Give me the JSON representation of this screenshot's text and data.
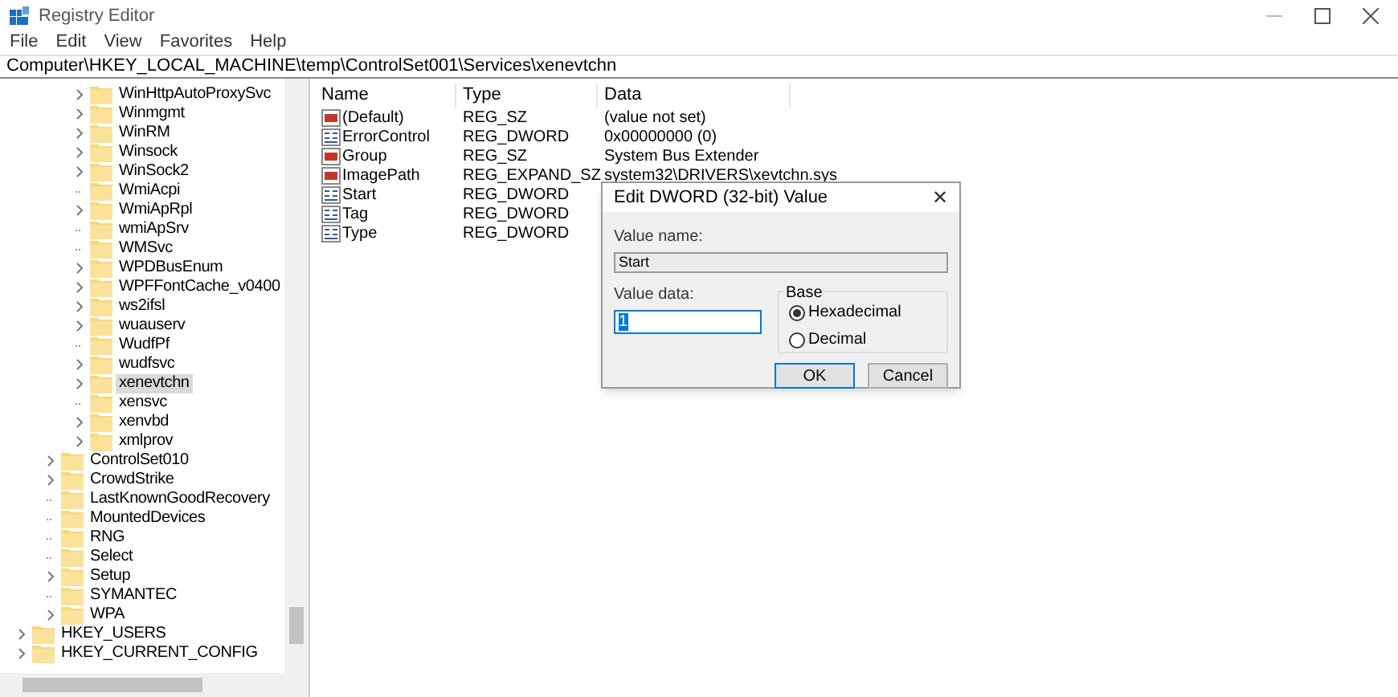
{
  "window": {
    "title": "Registry Editor"
  },
  "menu": [
    "File",
    "Edit",
    "View",
    "Favorites",
    "Help"
  ],
  "address": "Computer\\HKEY_LOCAL_MACHINE\\temp\\ControlSet001\\Services\\xenevtchn",
  "tree": {
    "services": [
      {
        "label": "WinHttpAutoProxySvc",
        "expandable": true,
        "selected": false
      },
      {
        "label": "Winmgmt",
        "expandable": true,
        "selected": false
      },
      {
        "label": "WinRM",
        "expandable": true,
        "selected": false
      },
      {
        "label": "Winsock",
        "expandable": true,
        "selected": false
      },
      {
        "label": "WinSock2",
        "expandable": true,
        "selected": false
      },
      {
        "label": "WmiAcpi",
        "expandable": false,
        "selected": false
      },
      {
        "label": "WmiApRpl",
        "expandable": true,
        "selected": false
      },
      {
        "label": "wmiApSrv",
        "expandable": false,
        "selected": false
      },
      {
        "label": "WMSvc",
        "expandable": false,
        "selected": false
      },
      {
        "label": "WPDBusEnum",
        "expandable": true,
        "selected": false
      },
      {
        "label": "WPFFontCache_v0400",
        "expandable": true,
        "selected": false
      },
      {
        "label": "ws2ifsl",
        "expandable": true,
        "selected": false
      },
      {
        "label": "wuauserv",
        "expandable": true,
        "selected": false
      },
      {
        "label": "WudfPf",
        "expandable": false,
        "selected": false
      },
      {
        "label": "wudfsvc",
        "expandable": true,
        "selected": false
      },
      {
        "label": "xenevtchn",
        "expandable": true,
        "selected": true
      },
      {
        "label": "xensvc",
        "expandable": false,
        "selected": false
      },
      {
        "label": "xenvbd",
        "expandable": true,
        "selected": false
      },
      {
        "label": "xmlprov",
        "expandable": true,
        "selected": false
      }
    ],
    "keys": [
      {
        "label": "ControlSet010",
        "expandable": true,
        "selected": false
      },
      {
        "label": "CrowdStrike",
        "expandable": true,
        "selected": false
      },
      {
        "label": "LastKnownGoodRecovery",
        "expandable": false,
        "selected": false
      },
      {
        "label": "MountedDevices",
        "expandable": false,
        "selected": false
      },
      {
        "label": "RNG",
        "expandable": false,
        "selected": false
      },
      {
        "label": "Select",
        "expandable": false,
        "selected": false
      },
      {
        "label": "Setup",
        "expandable": true,
        "selected": false
      },
      {
        "label": "SYMANTEC",
        "expandable": false,
        "selected": false
      },
      {
        "label": "WPA",
        "expandable": true,
        "selected": false
      }
    ],
    "hives": [
      {
        "label": "HKEY_USERS",
        "expandable": true,
        "selected": false
      },
      {
        "label": "HKEY_CURRENT_CONFIG",
        "expandable": true,
        "selected": false
      }
    ]
  },
  "table": {
    "columns": [
      "Name",
      "Type",
      "Data"
    ],
    "rows": [
      {
        "kind": "string",
        "name": "(Default)",
        "type": "REG_SZ",
        "data": "(value not set)"
      },
      {
        "kind": "binary",
        "name": "ErrorControl",
        "type": "REG_DWORD",
        "data": "0x00000000 (0)"
      },
      {
        "kind": "string",
        "name": "Group",
        "type": "REG_SZ",
        "data": "System Bus Extender"
      },
      {
        "kind": "string",
        "name": "ImagePath",
        "type": "REG_EXPAND_SZ",
        "data": "system32\\DRIVERS\\xevtchn.sys"
      },
      {
        "kind": "binary",
        "name": "Start",
        "type": "REG_DWORD"
      },
      {
        "kind": "binary",
        "name": "Tag",
        "type": "REG_DWORD"
      },
      {
        "kind": "binary",
        "name": "Type",
        "type": "REG_DWORD"
      }
    ]
  },
  "dialog": {
    "title": "Edit DWORD (32-bit) Value",
    "close": "✕",
    "value_name_label": "Value name:",
    "value_name": "Start",
    "value_data_label": "Value data:",
    "value_data": "1",
    "base_label": "Base",
    "bases": [
      {
        "label": "Hexadecimal",
        "selected": true
      },
      {
        "label": "Decimal",
        "selected": false
      }
    ],
    "buttons": [
      "OK",
      "Cancel"
    ]
  }
}
